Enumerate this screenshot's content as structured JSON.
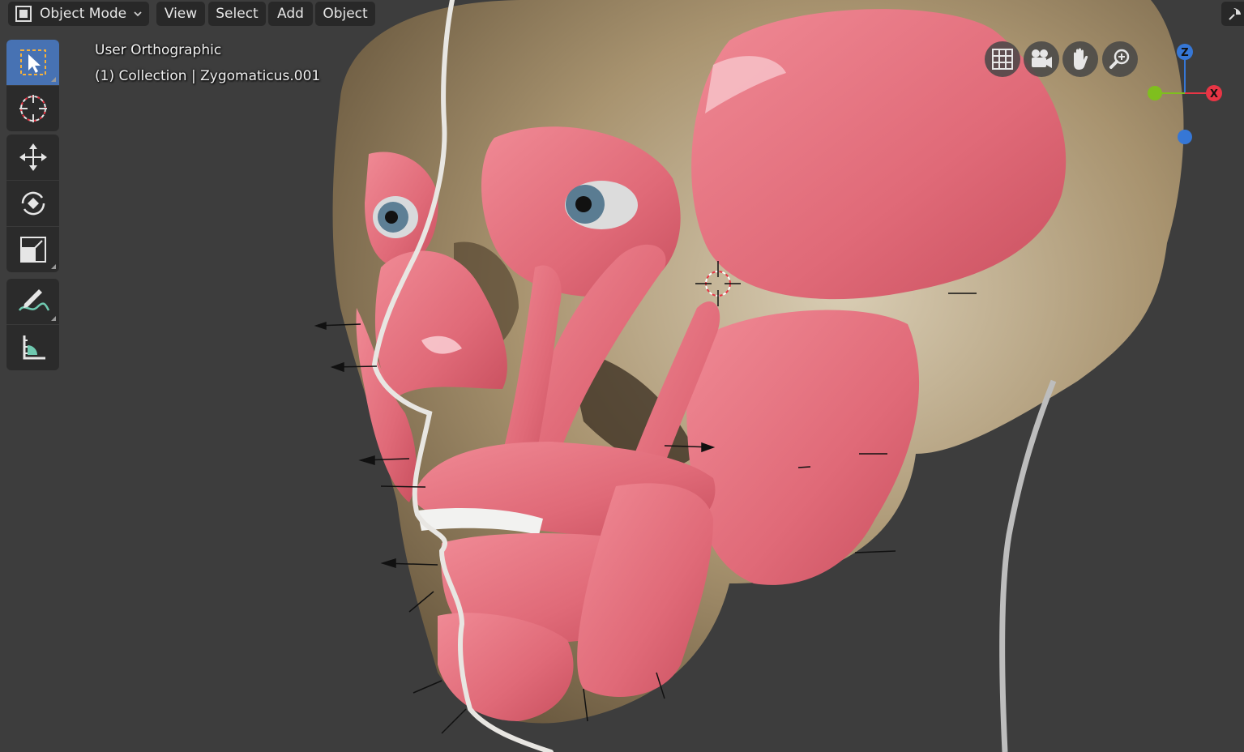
{
  "header": {
    "mode": "Object Mode",
    "menus": [
      "View",
      "Select",
      "Add",
      "Object"
    ]
  },
  "viewport": {
    "view_name": "User Orthographic",
    "active_object": "(1) Collection | Zygomaticus.001"
  },
  "toolbar": {
    "tools": [
      {
        "name": "select-box",
        "icon": "cursor-select-icon",
        "active": true
      },
      {
        "name": "cursor",
        "icon": "3d-cursor-icon"
      },
      {
        "name": "move",
        "icon": "move-icon"
      },
      {
        "name": "rotate",
        "icon": "rotate-icon"
      },
      {
        "name": "scale",
        "icon": "scale-icon"
      },
      {
        "name": "annotate",
        "icon": "annotate-pencil-icon"
      },
      {
        "name": "measure",
        "icon": "measure-ruler-icon"
      }
    ]
  },
  "navigation_gizmo": {
    "buttons": [
      "grid-toggle-icon",
      "camera-view-icon",
      "pan-hand-icon",
      "zoom-magnifier-icon"
    ]
  },
  "axis_gizmo": {
    "labels": {
      "z": "Z",
      "x": "X"
    },
    "colors": {
      "x": "#e83545",
      "y": "#7fbf1e",
      "z": "#3677d6"
    }
  },
  "colors": {
    "background": "#3d3d3d",
    "header_button": "#282828",
    "active_tool": "#4772b3",
    "muscle": "#e27380",
    "bone": "#b8a688"
  }
}
